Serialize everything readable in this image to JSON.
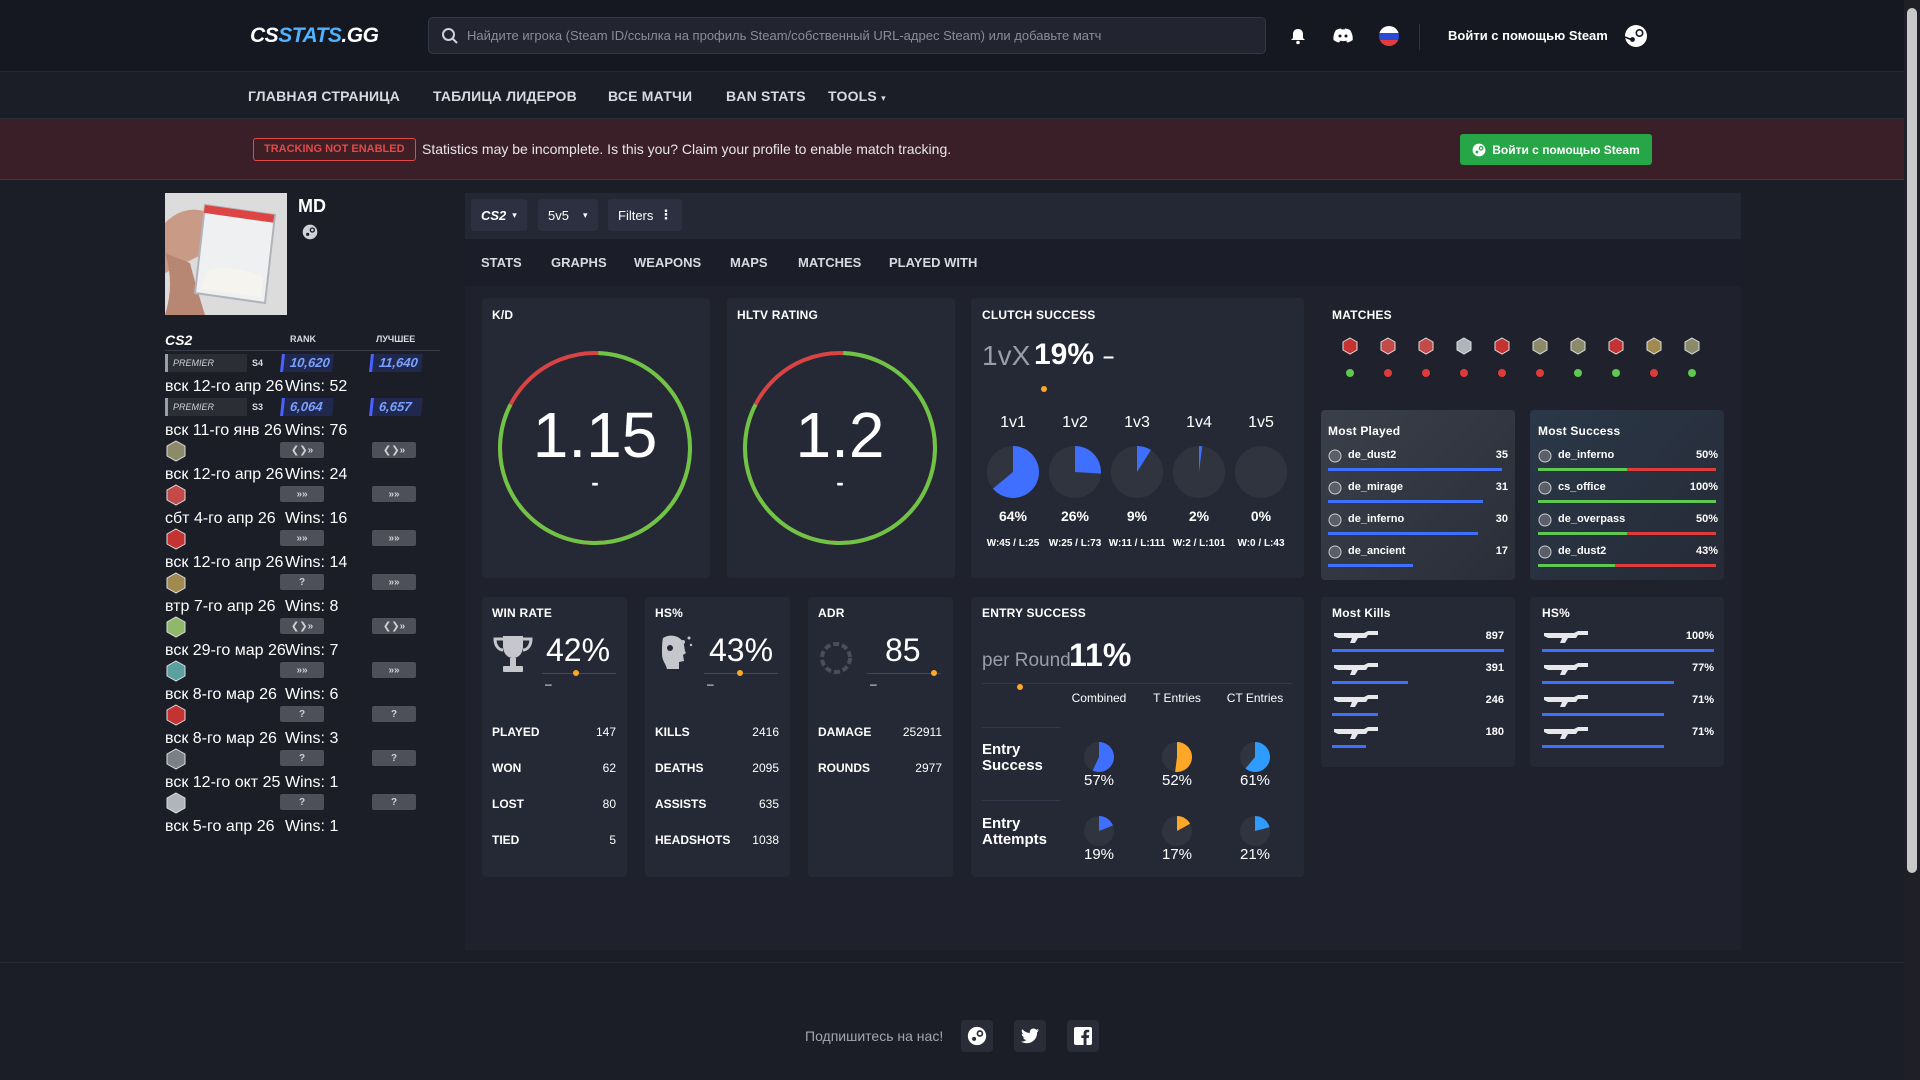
{
  "header": {
    "logo_a": "CS",
    "logo_b": "STATS",
    "logo_c": ".GG",
    "search_placeholder": "Найдите игрока (Steam ID/ссылка на профиль Steam/собственный URL-адрес Steam) или добавьте матч",
    "login": "Войти с помощью Steam"
  },
  "nav": [
    "ГЛАВНАЯ СТРАНИЦА",
    "ТАБЛИЦА ЛИДЕРОВ",
    "ВСЕ МАТЧИ",
    "BAN STATS",
    "TOOLS"
  ],
  "banner": {
    "badge": "TRACKING NOT ENABLED",
    "text": "Statistics may be incomplete. Is this you? Claim your profile to enable match tracking.",
    "button": "Войти с помощью Steam"
  },
  "profile": {
    "name": "MD"
  },
  "ranks": {
    "game": "CS2",
    "col_rank": "RANK",
    "col_best": "ЛУЧШЕЕ",
    "rows": [
      {
        "type": "premier",
        "season": "S4",
        "label": "PREMIER",
        "rank": "10,620",
        "best": "11,640",
        "date": "вск 12-го апр 26",
        "wins": "Wins: 52"
      },
      {
        "type": "premier",
        "season": "S3",
        "label": "PREMIER",
        "rank": "6,064",
        "best": "6,657",
        "date": "вск 11-го янв 26",
        "wins": "Wins: 76"
      },
      {
        "type": "map",
        "rank": "❮❯»",
        "best": "❮❯»",
        "date": "вск 12-го апр 26",
        "wins": "Wins: 24",
        "color": "#8b8b6a"
      },
      {
        "type": "map",
        "rank": "»»",
        "best": "»»",
        "date": "сбт 4-го апр 26",
        "wins": "Wins: 16",
        "color": "#c44a4a"
      },
      {
        "type": "map",
        "rank": "»»",
        "best": "»»",
        "date": "вск 12-го апр 26",
        "wins": "Wins: 14",
        "color": "#c43232"
      },
      {
        "type": "map",
        "rank": "?",
        "best": "»»",
        "date": "втр 7-го апр 26",
        "wins": "Wins: 8",
        "color": "#a08a50"
      },
      {
        "type": "map",
        "rank": "❮❯»",
        "best": "❮❯»",
        "date": "вск 29-го мар 26",
        "wins": "Wins: 7",
        "color": "#8fb86a"
      },
      {
        "type": "map",
        "rank": "»»",
        "best": "»»",
        "date": "вск 8-го мар 26",
        "wins": "Wins: 6",
        "color": "#5aa0a0"
      },
      {
        "type": "map",
        "rank": "?",
        "best": "?",
        "date": "вск 8-го мар 26",
        "wins": "Wins: 3",
        "color": "#c43232"
      },
      {
        "type": "map",
        "rank": "?",
        "best": "?",
        "date": "вск 12-го окт 25",
        "wins": "Wins: 1",
        "color": "#7a7f88"
      },
      {
        "type": "map",
        "rank": "?",
        "best": "?",
        "date": "вск 5-го апр 26",
        "wins": "Wins: 1",
        "color": "#b0b4bb"
      }
    ]
  },
  "filters": {
    "game": "CS2",
    "mode": "5v5",
    "filters": "Filters"
  },
  "tabs": [
    "STATS",
    "GRAPHS",
    "WEAPONS",
    "MAPS",
    "MATCHES",
    "PLAYED WITH"
  ],
  "kd": {
    "title": "K/D",
    "value": "1.15",
    "sub": "-",
    "ratio": 0.55
  },
  "hltv": {
    "title": "HLTV RATING",
    "value": "1.2",
    "sub": "-",
    "ratio": 0.6
  },
  "clutch": {
    "title": "CLUTCH SUCCESS",
    "prefix": "1vX",
    "value": "19%",
    "suffix": "–",
    "items": [
      {
        "label": "1v1",
        "pct": "64%",
        "frac": 0.64,
        "wl": "W:45 / L:25"
      },
      {
        "label": "1v2",
        "pct": "26%",
        "frac": 0.26,
        "wl": "W:25 / L:73"
      },
      {
        "label": "1v3",
        "pct": "9%",
        "frac": 0.09,
        "wl": "W:11 / L:111"
      },
      {
        "label": "1v4",
        "pct": "2%",
        "frac": 0.02,
        "wl": "W:2 / L:101"
      },
      {
        "label": "1v5",
        "pct": "0%",
        "frac": 0,
        "wl": "W:0 / L:43"
      }
    ]
  },
  "matches": {
    "title": "MATCHES",
    "results": [
      "win",
      "loss",
      "loss",
      "loss",
      "loss",
      "loss",
      "win",
      "win",
      "loss",
      "win"
    ]
  },
  "most_played": {
    "title": "Most Played",
    "rows": [
      {
        "map": "de_dust2",
        "val": "35",
        "frac": 0.98
      },
      {
        "map": "de_mirage",
        "val": "31",
        "frac": 0.87
      },
      {
        "map": "de_inferno",
        "val": "30",
        "frac": 0.84
      },
      {
        "map": "de_ancient",
        "val": "17",
        "frac": 0.48
      }
    ]
  },
  "most_success": {
    "title": "Most Success",
    "rows": [
      {
        "map": "de_inferno",
        "val": "50%",
        "frac": 0.5
      },
      {
        "map": "cs_office",
        "val": "100%",
        "frac": 1.0
      },
      {
        "map": "de_overpass",
        "val": "50%",
        "frac": 0.5
      },
      {
        "map": "de_dust2",
        "val": "43%",
        "frac": 0.43
      }
    ]
  },
  "winrate": {
    "title": "WIN RATE",
    "value": "42%",
    "dash": "–",
    "rows": [
      {
        "k": "PLAYED",
        "v": "147"
      },
      {
        "k": "WON",
        "v": "62"
      },
      {
        "k": "LOST",
        "v": "80"
      },
      {
        "k": "TIED",
        "v": "5"
      }
    ]
  },
  "hs": {
    "title": "HS%",
    "value": "43%",
    "dash": "–",
    "rows": [
      {
        "k": "KILLS",
        "v": "2416"
      },
      {
        "k": "DEATHS",
        "v": "2095"
      },
      {
        "k": "ASSISTS",
        "v": "635"
      },
      {
        "k": "HEADSHOTS",
        "v": "1038"
      }
    ]
  },
  "adr": {
    "title": "ADR",
    "value": "85",
    "dash": "–",
    "rows": [
      {
        "k": "DAMAGE",
        "v": "252911"
      },
      {
        "k": "ROUNDS",
        "v": "2977"
      }
    ]
  },
  "entry": {
    "title": "ENTRY SUCCESS",
    "prefix": "per Round",
    "value": "11%",
    "cols": [
      "Combined",
      "T Entries",
      "CT Entries"
    ],
    "rows": [
      {
        "label": "Entry Success",
        "cells": [
          {
            "pct": "57%",
            "frac": 0.57,
            "color": "#3f6fff"
          },
          {
            "pct": "52%",
            "frac": 0.52,
            "color": "#ffa726"
          },
          {
            "pct": "61%",
            "frac": 0.61,
            "color": "#2e9bff"
          }
        ]
      },
      {
        "label": "Entry Attempts",
        "cells": [
          {
            "pct": "19%",
            "frac": 0.19,
            "color": "#3f6fff"
          },
          {
            "pct": "17%",
            "frac": 0.17,
            "color": "#ffa726"
          },
          {
            "pct": "21%",
            "frac": 0.21,
            "color": "#2e9bff"
          }
        ]
      }
    ]
  },
  "most_kills": {
    "title": "Most Kills",
    "rows": [
      {
        "v": "897",
        "frac": 1.0
      },
      {
        "v": "391",
        "frac": 0.44
      },
      {
        "v": "246",
        "frac": 0.27
      },
      {
        "v": "180",
        "frac": 0.2
      }
    ]
  },
  "hs_weapons": {
    "title": "HS%",
    "rows": [
      {
        "v": "100%",
        "frac": 1.0
      },
      {
        "v": "77%",
        "frac": 0.77
      },
      {
        "v": "71%",
        "frac": 0.71
      },
      {
        "v": "71%",
        "frac": 0.71
      }
    ]
  },
  "footer": {
    "follow": "Подпишитесь на нас!"
  }
}
